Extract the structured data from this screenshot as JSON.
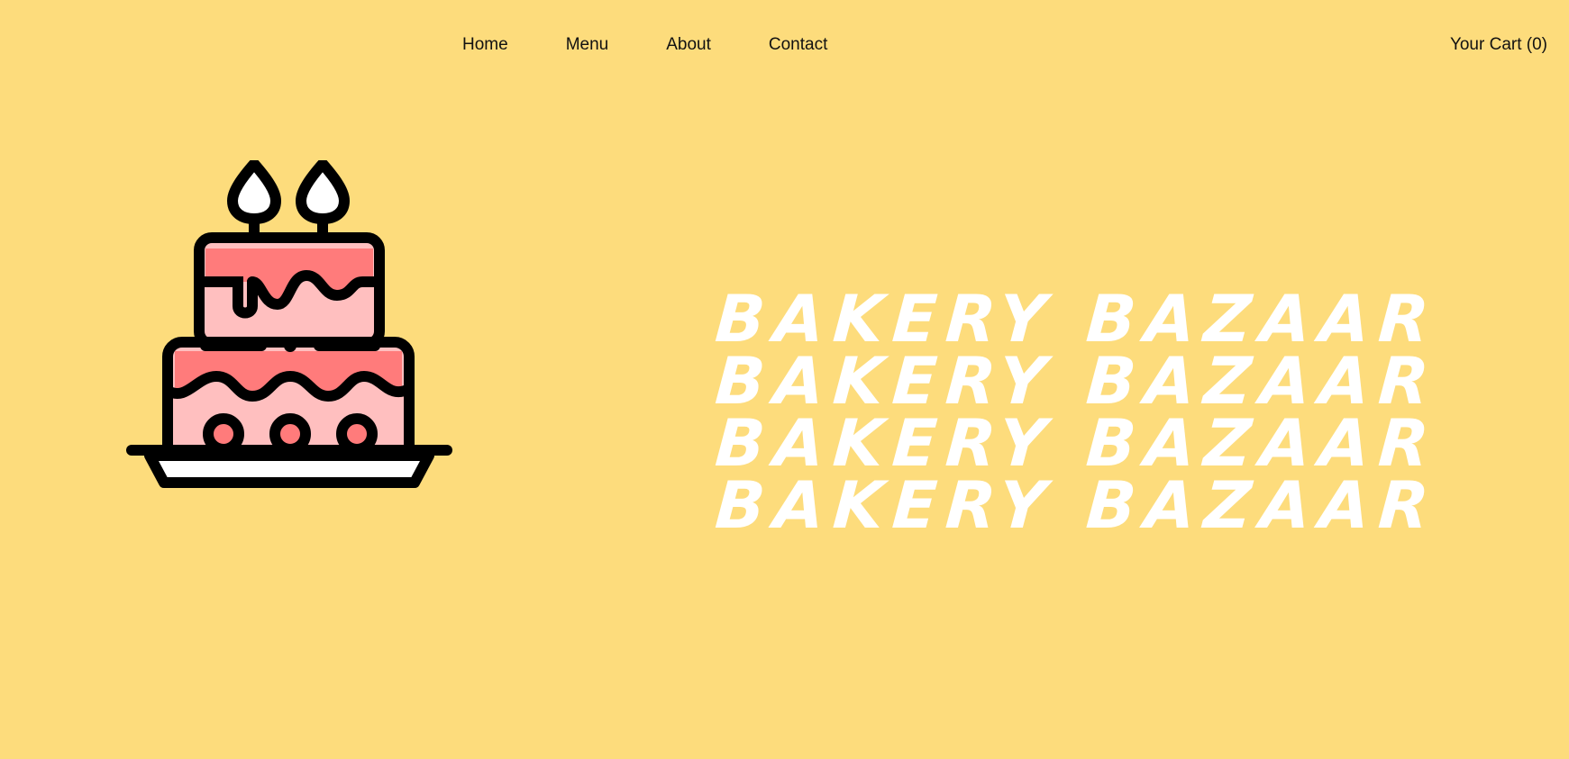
{
  "nav": {
    "links": [
      {
        "label": "Home"
      },
      {
        "label": "Menu"
      },
      {
        "label": "About"
      },
      {
        "label": "Contact"
      }
    ],
    "cart_label": "Your Cart (0)"
  },
  "hero": {
    "title_lines": [
      "BAKERY BAZAAR",
      "BAKERY BAZAAR",
      "BAKERY BAZAAR",
      "BAKERY BAZAAR"
    ],
    "image_icon": "birthday-cake-icon"
  },
  "colors": {
    "background": "#FDDC7C",
    "title": "#FFFFFF",
    "cake_frosting": "#FF7B7B",
    "cake_body": "#FFBFBF",
    "outline": "#000000"
  }
}
